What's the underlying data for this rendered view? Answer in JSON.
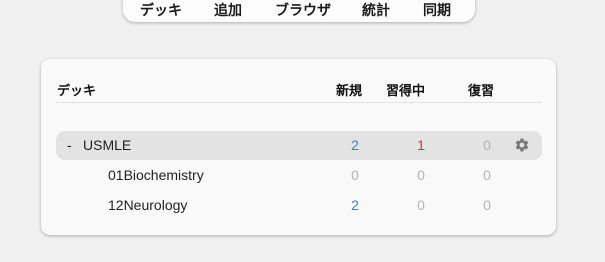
{
  "nav": {
    "decks": "デッキ",
    "add": "追加",
    "browse": "ブラウザ",
    "stats": "統計",
    "sync": "同期"
  },
  "table": {
    "headers": {
      "deck": "デッキ",
      "new": "新規",
      "learn": "習得中",
      "due": "復習"
    },
    "rows": [
      {
        "collapse": "-",
        "name": "USMLE",
        "new": "2",
        "learn": "1",
        "due": "0",
        "current": true
      },
      {
        "name": "01Biochemistry",
        "new": "0",
        "learn": "0",
        "due": "0"
      },
      {
        "name": "12Neurology",
        "new": "2",
        "learn": "0",
        "due": "0"
      }
    ]
  },
  "icons": {
    "options": "gear-icon"
  },
  "colors": {
    "new": "#4a7bd6",
    "learn": "#cc3a3a",
    "zero": "#b4b4b4",
    "current_row": "#e3e3e3"
  }
}
